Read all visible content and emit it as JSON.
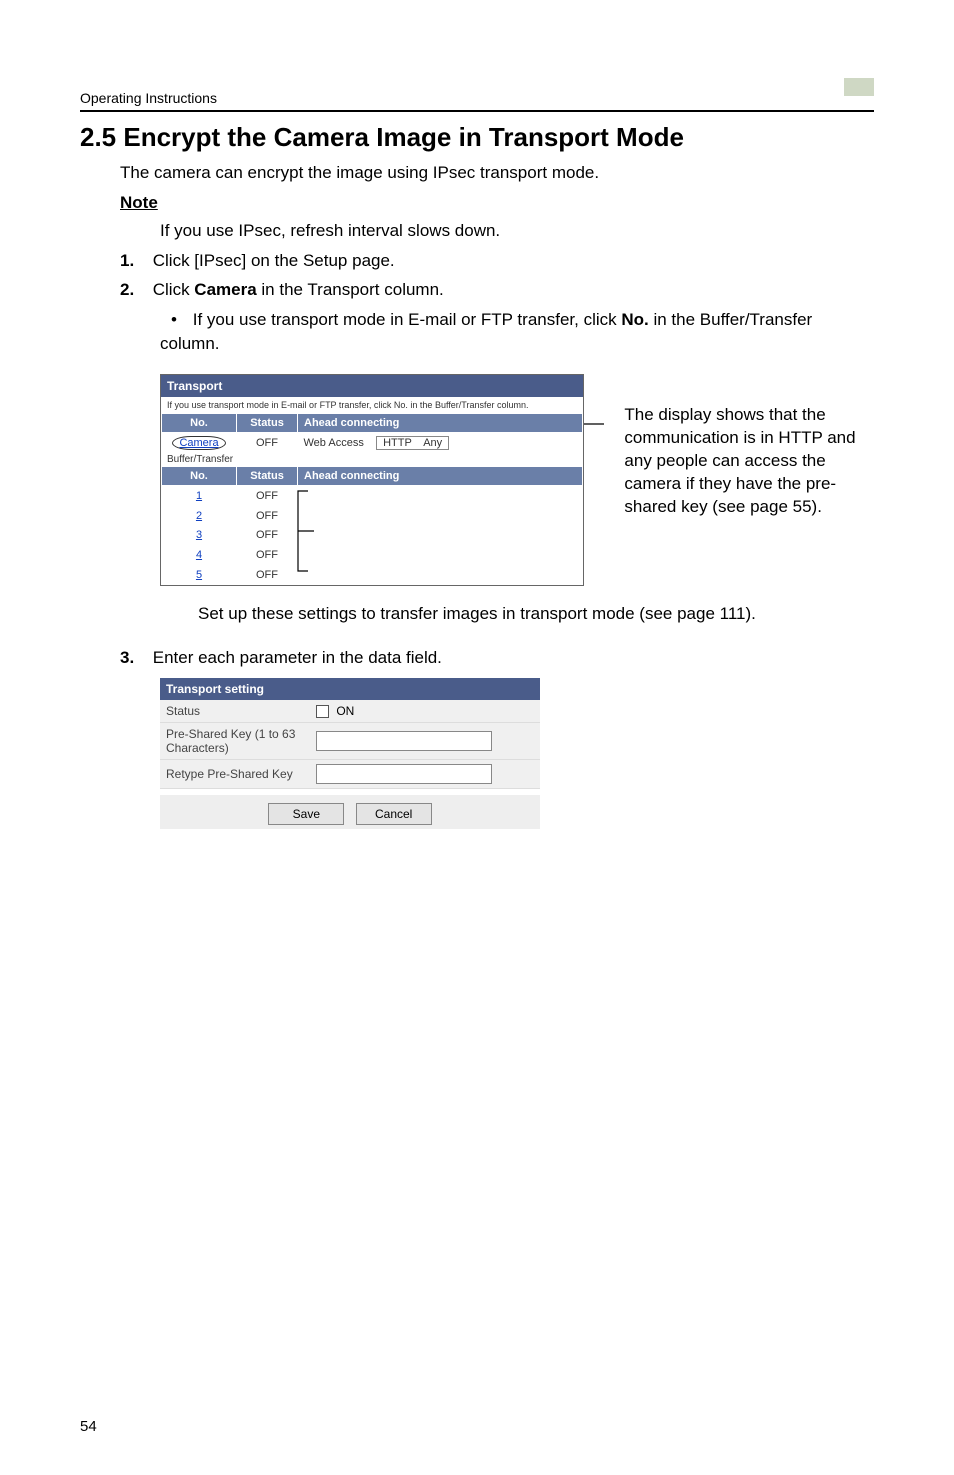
{
  "header": {
    "text": "Operating Instructions"
  },
  "title": "2.5   Encrypt the Camera Image in Transport Mode",
  "intro": "The camera can encrypt the image using IPsec transport mode.",
  "note_heading": "Note",
  "note_body": "If you use IPsec, refresh interval slows down.",
  "step1": {
    "num": "1.",
    "text": "Click [IPsec] on the Setup page."
  },
  "step2": {
    "num": "2.",
    "text_pre": "Click ",
    "text_bold": "Camera",
    "text_post": " in the Transport column.",
    "bullet_pre": "If you use transport mode in E-mail or FTP transfer, click ",
    "bullet_bold": "No.",
    "bullet_post": " in the Buffer/Transfer column."
  },
  "transport_box": {
    "title": "Transport",
    "tiny_note": "If you use transport mode in E-mail or FTP transfer, click No. in the Buffer/Transfer column.",
    "cols": {
      "no": "No.",
      "status": "Status",
      "ahead": "Ahead connecting"
    },
    "row1": {
      "no": "Camera",
      "status": "OFF",
      "webaccess_label": "Web Access",
      "http": "HTTP",
      "any": "Any"
    },
    "buffer_heading": "Buffer/Transfer",
    "cols2": {
      "no": "No.",
      "status": "Status",
      "ahead": "Ahead connecting"
    },
    "rows": [
      {
        "no": "1",
        "status": "OFF"
      },
      {
        "no": "2",
        "status": "OFF"
      },
      {
        "no": "3",
        "status": "OFF"
      },
      {
        "no": "4",
        "status": "OFF"
      },
      {
        "no": "5",
        "status": "OFF"
      }
    ]
  },
  "annotation": "The display shows that the communication is in HTTP and any people can access the camera if they have the pre-shared key (see page 55).",
  "below_figure": "Set up these settings to transfer images in transport mode (see page 111).",
  "step3": {
    "num": "3.",
    "text": "Enter each parameter in the data field."
  },
  "transport_setting": {
    "title": "Transport setting",
    "status_label": "Status",
    "status_on": "ON",
    "psk_label": "Pre-Shared Key (1 to 63 Characters)",
    "retype_label": "Retype Pre-Shared Key",
    "save": "Save",
    "cancel": "Cancel"
  },
  "page_number": "54"
}
